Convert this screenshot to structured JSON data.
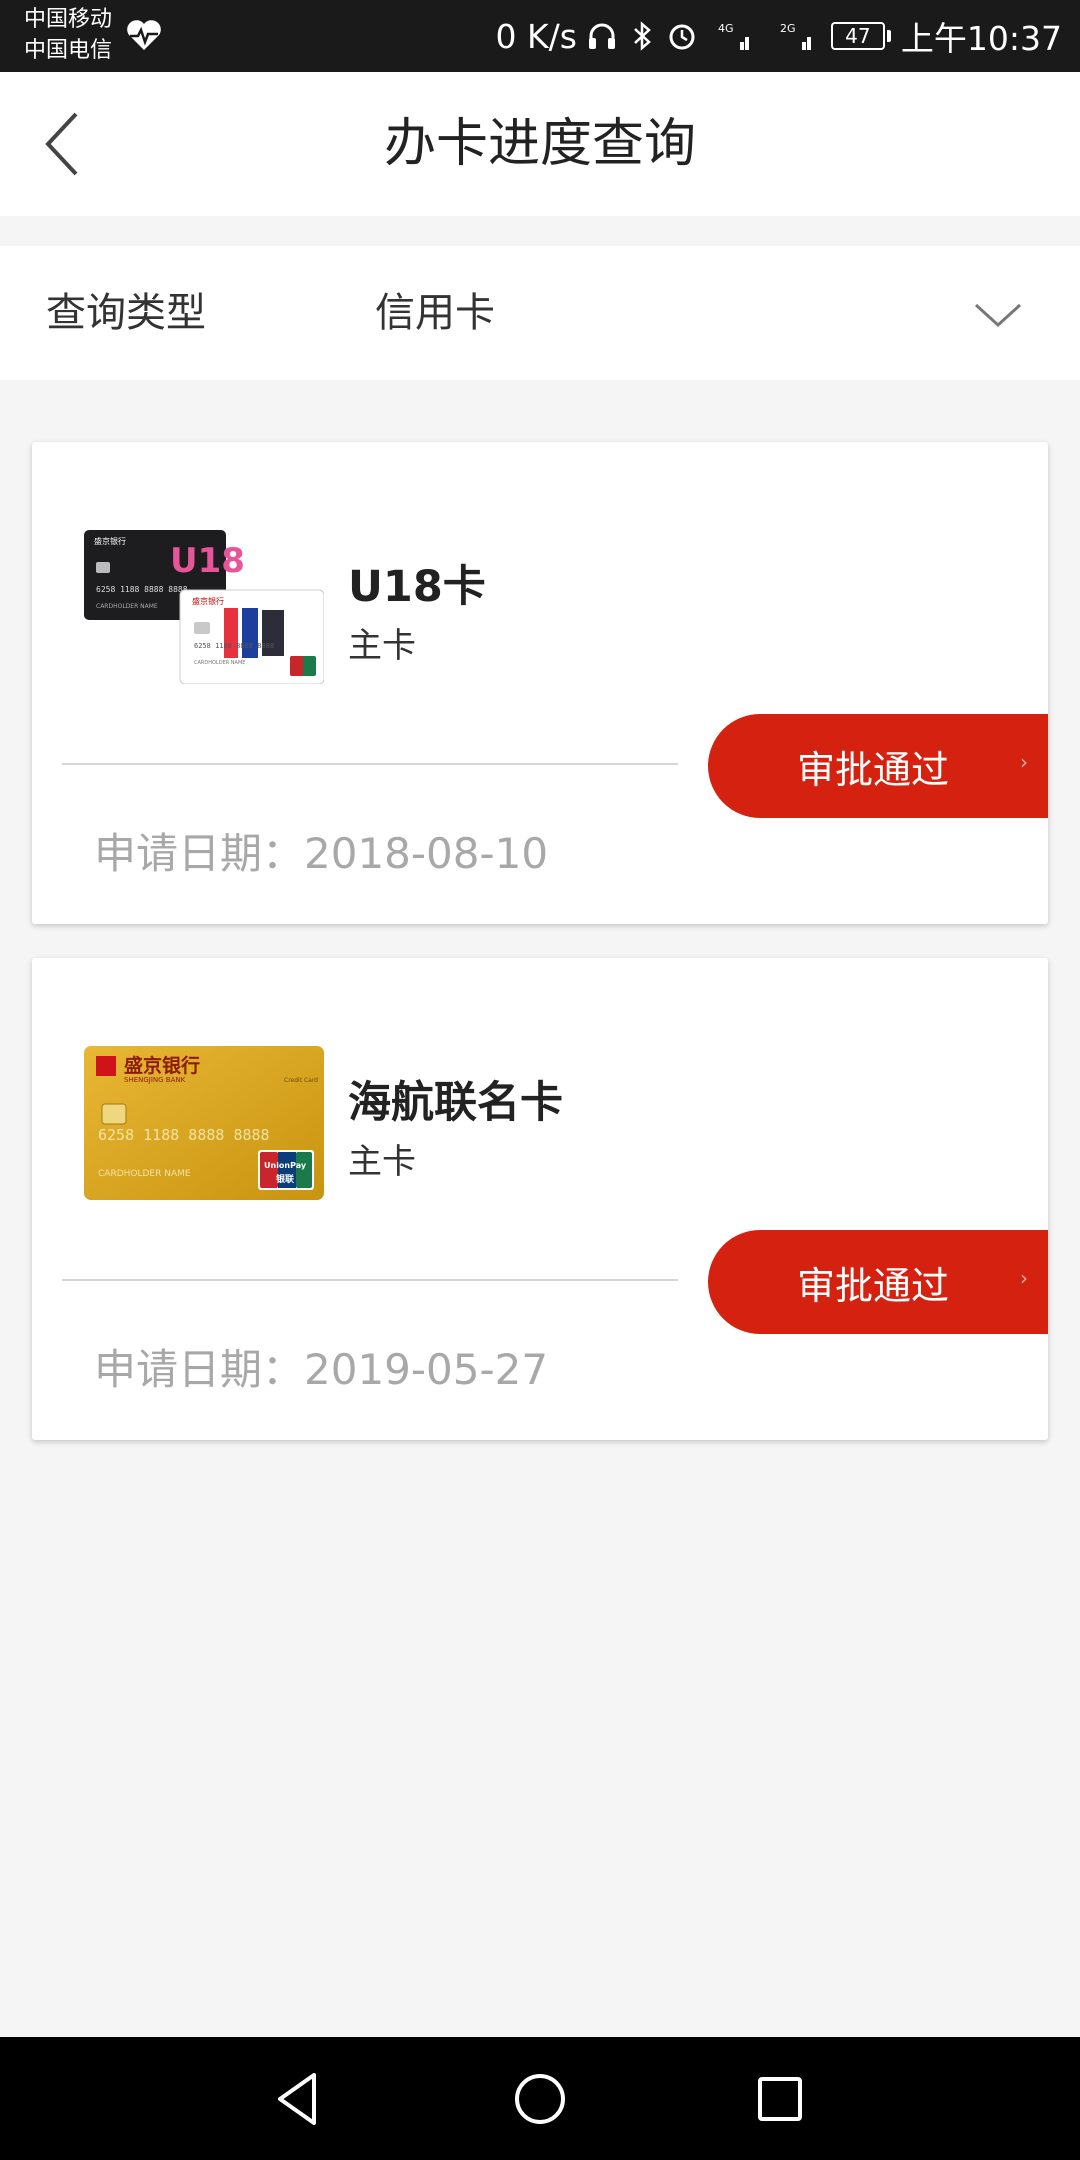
{
  "status_bar": {
    "carrier1": "中国移动",
    "carrier2": "中国电信",
    "network_speed": "0 K/s",
    "signal1_label": "4G",
    "signal2_label": "2G",
    "battery": "47",
    "time": "上午10:37"
  },
  "header": {
    "title": "办卡进度查询"
  },
  "query": {
    "label": "查询类型",
    "value": "信用卡"
  },
  "cards": [
    {
      "name": "U18卡",
      "subtype": "主卡",
      "status": "审批通过",
      "date_label": "申请日期：",
      "date": "2018-08-10",
      "arrow": "›"
    },
    {
      "name": "海航联名卡",
      "subtype": "主卡",
      "status": "审批通过",
      "date_label": "申请日期：",
      "date": "2019-05-27",
      "arrow": "›"
    }
  ],
  "card_art": {
    "u18_text": "U18",
    "card_number": "6258 1188 8888 8888",
    "cardholder": "CARDHOLDER NAME",
    "bank_name": "盛京银行",
    "bank_name_en": "SHENGJING BANK",
    "credit_card": "Credit Card",
    "unionpay": "UnionPay",
    "unionpay_cn": "银联"
  },
  "colors": {
    "accent": "#d52210",
    "date_gray": "#a8a8a8",
    "gold_card": "#d9a520"
  }
}
